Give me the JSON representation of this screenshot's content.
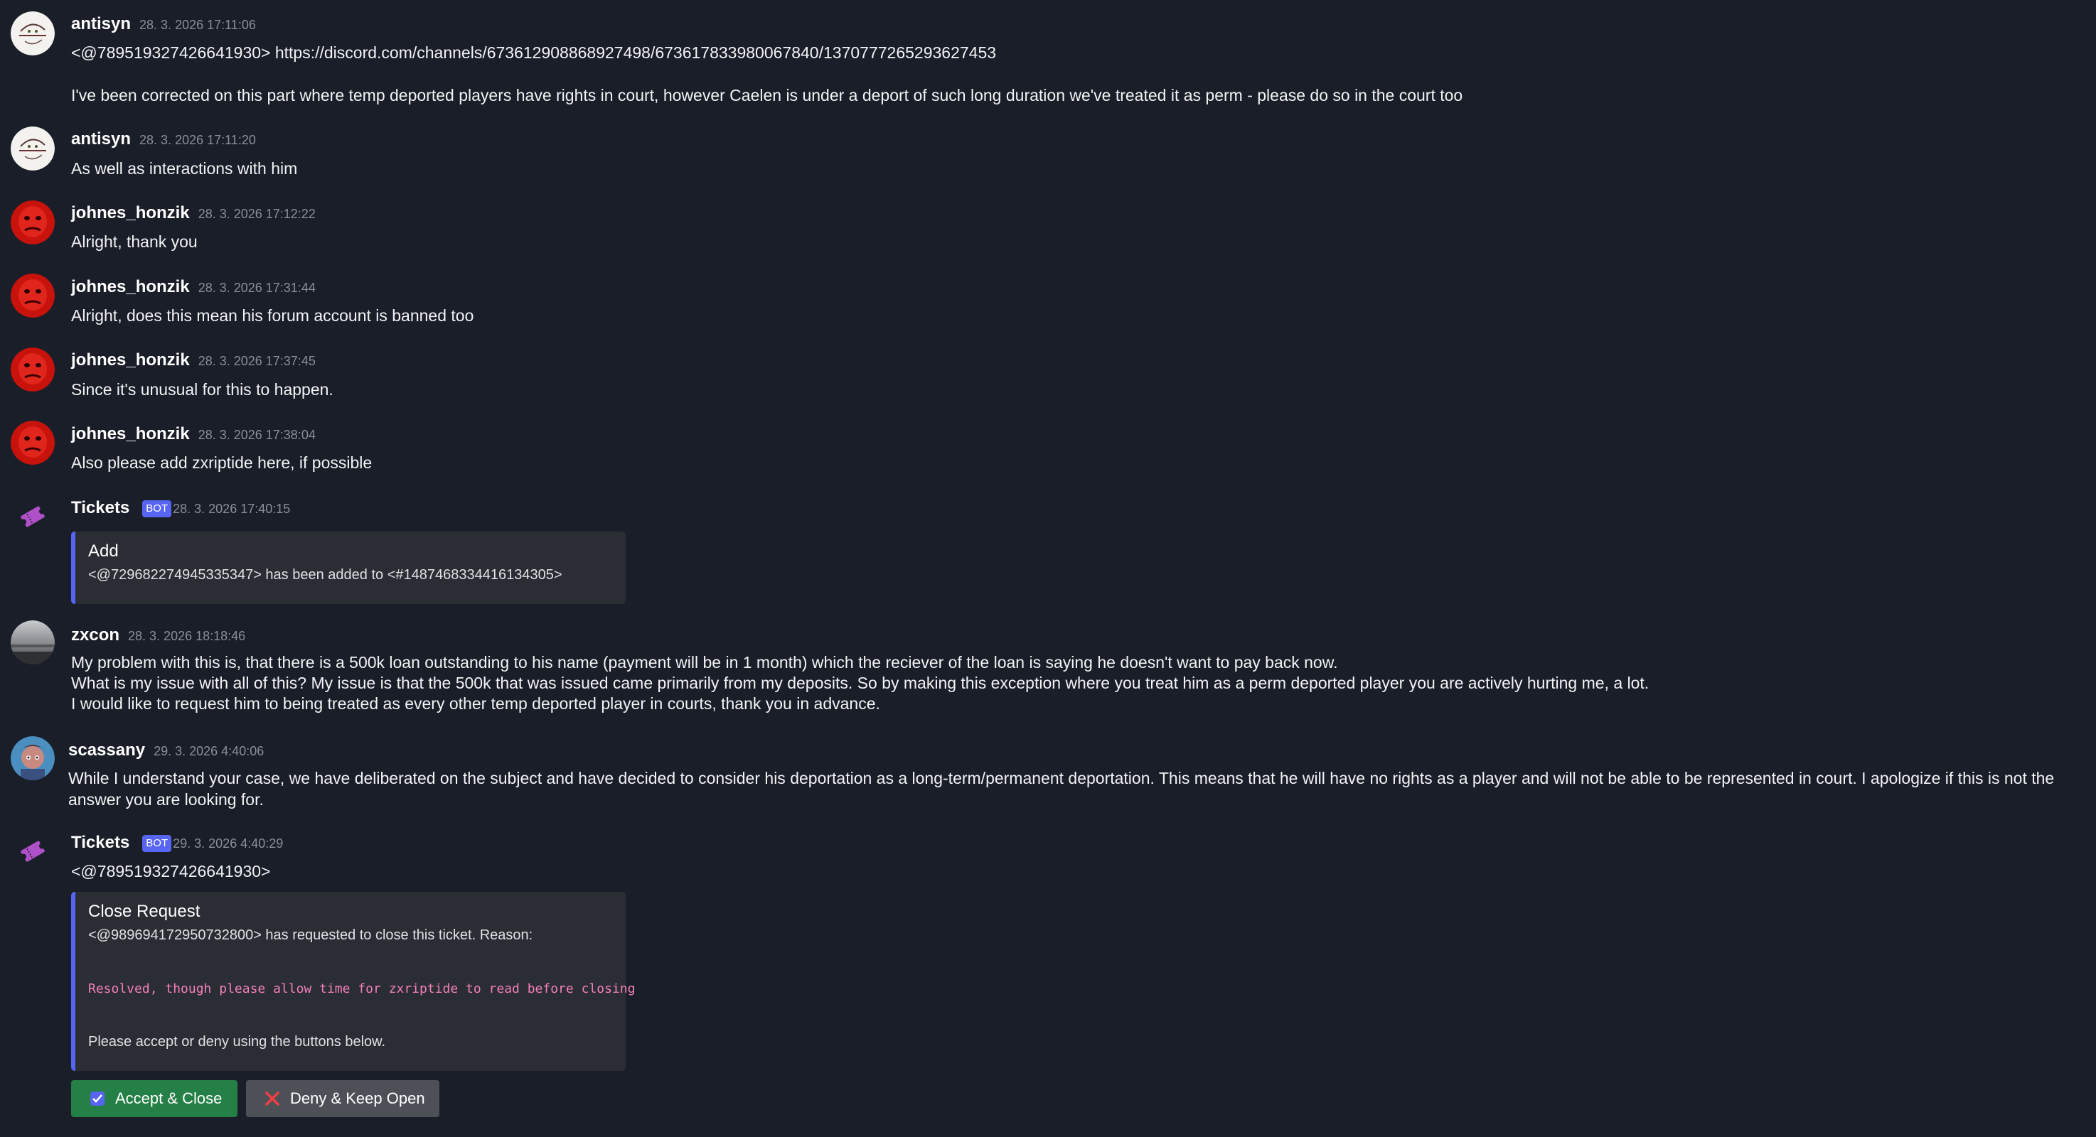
{
  "messages": [
    {
      "author": "antisyn",
      "timestamp": "28. 3. 2026 17:11:06",
      "lines": [
        "<@789519327426641930> https://discord.com/channels/673612908868927498/673617833980067840/1370777265293627453",
        "I've been corrected on this part where temp deported players have rights in court, however Caelen is under a deport of such long duration we've treated it as perm - please do so in the court too"
      ]
    },
    {
      "author": "antisyn",
      "timestamp": "28. 3. 2026 17:11:20",
      "lines": [
        "As well as interactions with him"
      ]
    },
    {
      "author": "johnes_honzik",
      "timestamp": "28. 3. 2026 17:12:22",
      "lines": [
        "Alright, thank you"
      ]
    },
    {
      "author": "johnes_honzik",
      "timestamp": "28. 3. 2026 17:31:44",
      "lines": [
        "Alright, does this mean his forum account is banned too"
      ]
    },
    {
      "author": "johnes_honzik",
      "timestamp": "28. 3. 2026 17:37:45",
      "lines": [
        "Since it's unusual for this to happen."
      ]
    },
    {
      "author": "johnes_honzik",
      "timestamp": "28. 3. 2026 17:38:04",
      "lines": [
        "Also please add zxriptide here, if possible"
      ]
    },
    {
      "author": "Tickets",
      "badge": "BOT",
      "timestamp": "28. 3. 2026 17:40:15",
      "embed": {
        "title": "Add",
        "description": "<@729682274945335347> has been added to <#1487468334416134305>"
      }
    },
    {
      "author": "zxcon",
      "timestamp": "28. 3. 2026 18:18:46",
      "lines": [
        "My problem with this is, that there is a 500k loan outstanding to his name (payment will be in 1 month) which the reciever of the loan is saying he doesn't want to pay back now.",
        "What is my issue with all of this? My issue is that the 500k that was issued came primarily from my deposits. So by making this exception where you treat him as a perm deported player you are actively hurting me, a lot.",
        "I would like to request him to being treated as every other temp deported player in courts, thank you in advance."
      ]
    },
    {
      "author": "scassany",
      "timestamp": "29. 3. 2026 4:40:06",
      "lines": [
        "While I understand your case, we have deliberated on the subject and have decided to consider his deportation as a long-term/permanent deportation. This means that he will have no rights as a player and will not be able to be represented in court. I apologize if this is not the answer you are looking for."
      ]
    },
    {
      "author": "Tickets",
      "badge": "BOT",
      "timestamp": "29. 3. 2026 4:40:29",
      "lines": [
        "<@789519327426641930>"
      ],
      "embed": {
        "title": "Close Request",
        "description": "<@989694172950732800> has requested to close this ticket. Reason:",
        "code": "Resolved, though please allow time for zxriptide to read before closing",
        "footer": "Please accept or deny using the buttons below."
      },
      "buttons": {
        "accept": "Accept & Close",
        "deny": "Deny & Keep Open"
      }
    }
  ],
  "colors": {
    "background": "#1a1e29",
    "embed_bg": "#2b2d35",
    "embed_accent": "#5865f2",
    "accept_green": "#248046",
    "deny_gray": "#4e5058",
    "code_pink": "#f47fba"
  }
}
